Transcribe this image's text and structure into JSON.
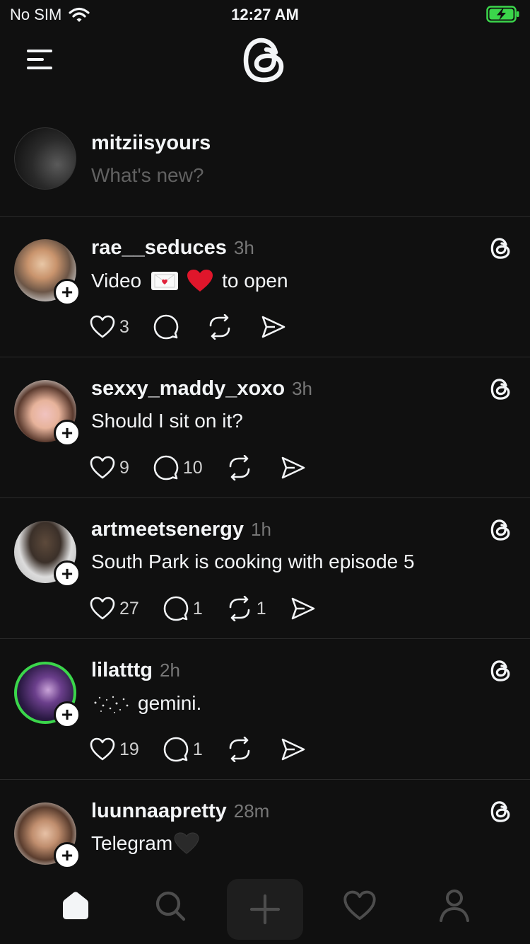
{
  "status_bar": {
    "carrier": "No SIM",
    "time": "12:27 AM"
  },
  "composer": {
    "username": "mitziisyours",
    "placeholder": "What's new?"
  },
  "posts": [
    {
      "username": "rae__seduces",
      "time": "3h",
      "text_before": "Video",
      "text_after": "to open",
      "likes": "3",
      "replies": "",
      "reposts": ""
    },
    {
      "username": "sexxy_maddy_xoxo",
      "time": "3h",
      "text": "Should I sit on it?",
      "likes": "9",
      "replies": "10",
      "reposts": ""
    },
    {
      "username": "artmeetsenergy",
      "time": "1h",
      "text": "South Park is cooking with episode 5",
      "likes": "27",
      "replies": "1",
      "reposts": "1"
    },
    {
      "username": "lilatttg",
      "time": "2h",
      "text": "gemini.",
      "likes": "19",
      "replies": "1",
      "reposts": ""
    },
    {
      "username": "luunnaapretty",
      "time": "28m",
      "text": "Telegram"
    }
  ],
  "icons": {
    "menu": "menu-icon",
    "logo": "threads-logo-icon",
    "like": "heart-icon",
    "reply": "comment-icon",
    "repost": "repost-icon",
    "share": "send-icon",
    "home": "home-icon",
    "search": "search-icon",
    "compose": "plus-icon",
    "activity": "heart-icon",
    "profile": "profile-icon"
  },
  "colors": {
    "background": "#101010",
    "text": "#f3f5f7",
    "muted": "#777777",
    "story_ring": "#3bd64b",
    "battery": "#3bd64b"
  }
}
